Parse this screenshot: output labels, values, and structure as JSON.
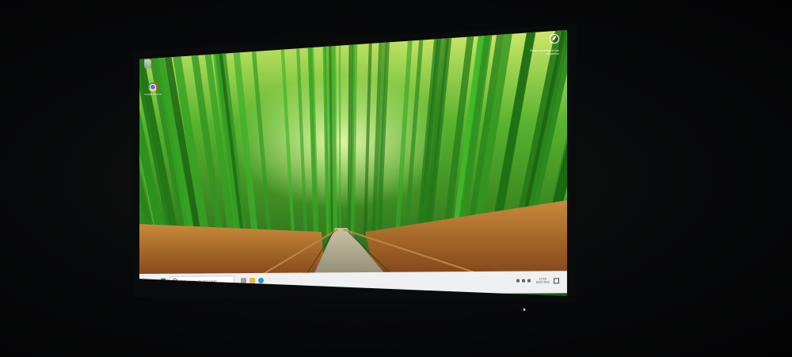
{
  "desktop": {
    "wallpaper_name": "bamboo-forest-path",
    "icons": [
      {
        "label": "Google Chrome",
        "icon": "chrome-icon"
      },
      {
        "label": "",
        "icon": "recycle-bin-icon"
      }
    ],
    "notification": {
      "text": "Dołącz do wersji na tym urządzeniu",
      "icon": "activate-windows-icon"
    }
  },
  "taskbar": {
    "start_icon": "windows-logo-icon",
    "search_placeholder": "Wpisz tutaj, aby wyszukać",
    "pinned_apps": [
      "task-view-icon",
      "file-explorer-icon",
      "edge-icon"
    ],
    "clock_time": "17:19",
    "clock_date": "18.07.2022",
    "tray_icons": [
      "chevron-up-icon",
      "network-icon",
      "volume-icon"
    ]
  },
  "colors": {
    "taskbar_bg": "#eef0f2",
    "bezel": "#0a0b0c",
    "room": "#050607",
    "bamboo_green": "#3e9a2a"
  }
}
